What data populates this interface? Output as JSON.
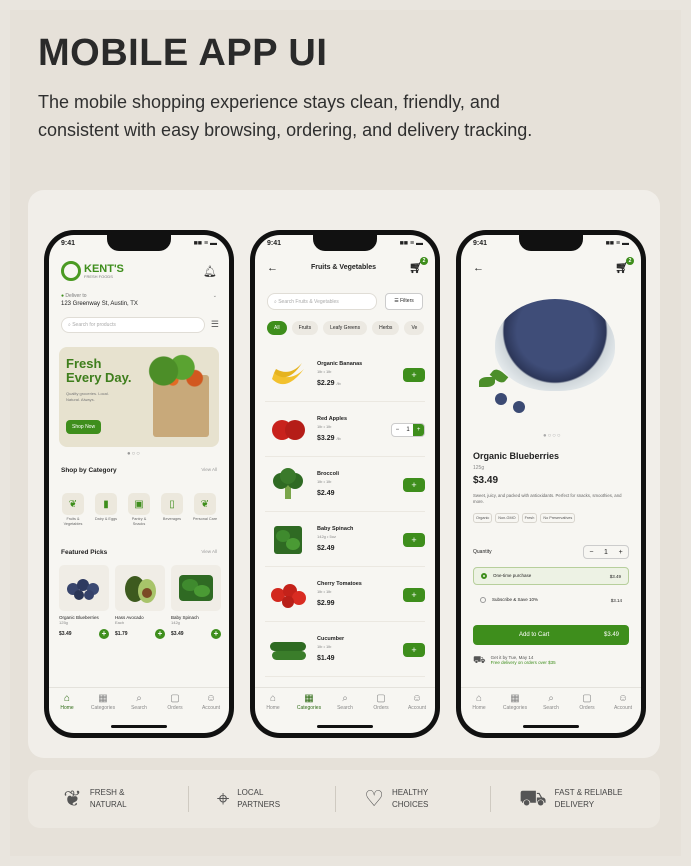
{
  "headline": "MOBILE APP UI",
  "subhead": "The mobile shopping experience stays clean, friendly, and consistent with easy browsing, ordering, and delivery tracking.",
  "status_time": "9:41",
  "status_icons": "■■ ≡ ▬",
  "colors": {
    "accent": "#3e8e1c",
    "background": "#e9e5de"
  },
  "home": {
    "logo_text": "KENT'S",
    "logo_sub": "FRESH FOODS",
    "deliver_label": "Deliver to",
    "deliver_address": "123 Greenway St, Austin, TX",
    "search_placeholder": "Search for products",
    "banner_title_1": "Fresh",
    "banner_title_2": "Every Day.",
    "banner_text": "Quality groceries. Local. Natural. Always.",
    "banner_button": "Shop Now",
    "shop_by_category": "Shop by Category",
    "view_all": "View All",
    "categories": [
      {
        "label": "Fruits & Vegetables",
        "icon": "leaf-icon"
      },
      {
        "label": "Dairy & Eggs",
        "icon": "bottle-icon"
      },
      {
        "label": "Pantry & Snacks",
        "icon": "jar-icon"
      },
      {
        "label": "Beverages",
        "icon": "beverage-icon"
      },
      {
        "label": "Personal Care",
        "icon": "leaf-icon"
      }
    ],
    "featured_picks": "Featured Picks",
    "picks": [
      {
        "name": "Organic Blueberries",
        "weight": "125g",
        "price": "$3.49"
      },
      {
        "name": "Hass Avocado",
        "weight": "Each",
        "price": "$1.79"
      },
      {
        "name": "Baby Spinach",
        "weight": "142g",
        "price": "$3.49"
      }
    ]
  },
  "tabs": [
    "Home",
    "Categories",
    "Search",
    "Orders",
    "Account"
  ],
  "listing": {
    "title": "Fruits & Vegetables",
    "cart_count": "2",
    "search_placeholder": "Search Fruits & Vegetables",
    "filters": "Filters",
    "chips": [
      "All",
      "Fruits",
      "Leafy Greens",
      "Herbs",
      "Ve"
    ],
    "products": [
      {
        "name": "Organic Bananas",
        "weight": "1lb • 1lb",
        "price": "$2.29",
        "unit": "/lb",
        "control": "add"
      },
      {
        "name": "Red Apples",
        "weight": "1lb • 1lb",
        "price": "$3.29",
        "unit": "/lb",
        "control": "stepper",
        "qty": "1"
      },
      {
        "name": "Broccoli",
        "weight": "1lb • 1lb",
        "price": "$2.49",
        "unit": "",
        "control": "add"
      },
      {
        "name": "Baby Spinach",
        "weight": "142g • 5oz",
        "price": "$2.49",
        "unit": "",
        "control": "add"
      },
      {
        "name": "Cherry Tomatoes",
        "weight": "1lb • 1lb",
        "price": "$2.99",
        "unit": "",
        "control": "add"
      },
      {
        "name": "Cucumber",
        "weight": "1lb • 1lb",
        "price": "$1.49",
        "unit": "",
        "control": "add"
      }
    ]
  },
  "detail": {
    "cart_count": "2",
    "title": "Organic Blueberries",
    "weight": "125g",
    "price": "$3.49",
    "description": "Sweet, juicy, and packed with antioxidants. Perfect for snacks, smoothies, and more.",
    "tags": [
      "Organic",
      "Non-GMO",
      "Fresh",
      "No Preservatives"
    ],
    "quantity_label": "Quantity",
    "qty": "1",
    "options": [
      {
        "label": "One-time purchase",
        "price": "$3.49"
      },
      {
        "label": "Subscribe & Save 10%",
        "price": "$3.14"
      }
    ],
    "add_to_cart": "Add to Cart",
    "add_to_cart_price": "$3.49",
    "delivery_line1": "Get it by Tue, May 14",
    "delivery_line2": "Free delivery on orders over $35"
  },
  "features": [
    {
      "label": "FRESH & NATURAL",
      "icon": "leaf-icon"
    },
    {
      "label": "LOCAL PARTNERS",
      "icon": "location-pin-icon"
    },
    {
      "label": "HEALTHY CHOICES",
      "icon": "heart-icon"
    },
    {
      "label": "FAST & RELIABLE DELIVERY",
      "icon": "truck-icon"
    }
  ]
}
